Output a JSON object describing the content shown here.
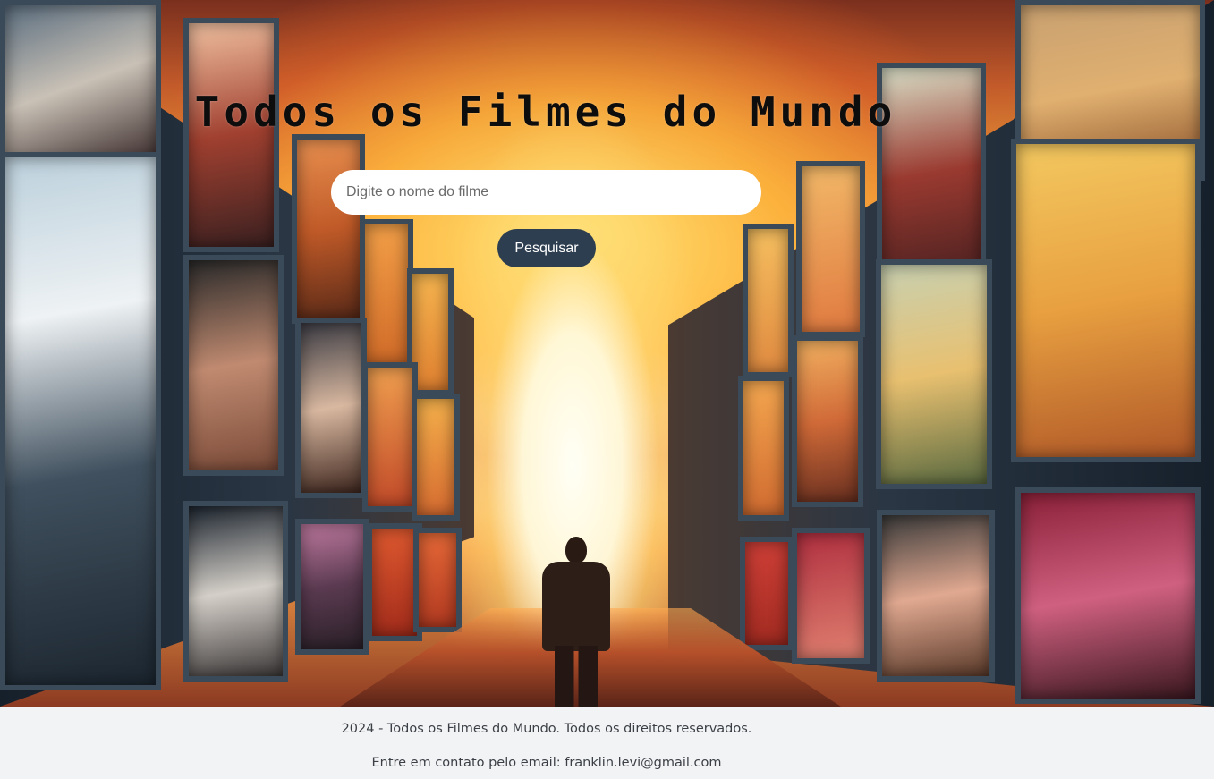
{
  "header": {
    "title": "Todos os Filmes do Mundo"
  },
  "search": {
    "placeholder": "Digite o nome do filme",
    "value": "",
    "button_label": "Pesquisar"
  },
  "footer": {
    "copyright": "2024 - Todos os Filmes do Mundo. Todos os direitos reservados.",
    "contact": "Entre em contato pelo email: franklin.levi@gmail.com"
  },
  "colors": {
    "button_background": "#2d3e50",
    "button_text": "#ffffff",
    "footer_background": "#f2f3f5",
    "title_text": "#0d0d0d"
  }
}
